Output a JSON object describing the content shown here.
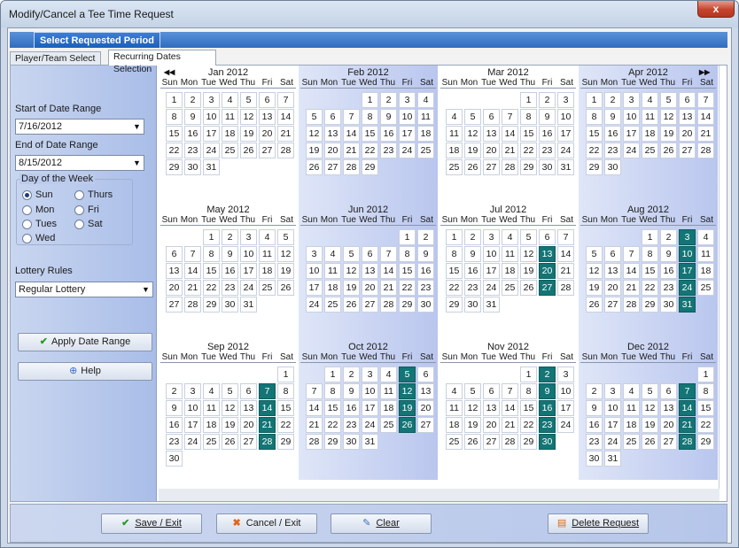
{
  "window": {
    "title": "Modify/Cancel a Tee Time Request",
    "close_label": "x"
  },
  "period_header": {
    "label": "Select Requested Period"
  },
  "tabs": [
    {
      "label": "Player/Team Select",
      "active": false
    },
    {
      "label": "Recurring Dates Selection",
      "active": true
    }
  ],
  "sidebar": {
    "start_label": "Start of Date Range",
    "start_value": "7/16/2012",
    "end_label": "End of Date Range",
    "end_value": "8/15/2012",
    "dow_title": "Day of the Week",
    "days": [
      {
        "label": "Sun",
        "selected": true
      },
      {
        "label": "Thurs",
        "selected": false
      },
      {
        "label": "Mon",
        "selected": false
      },
      {
        "label": "Fri",
        "selected": false
      },
      {
        "label": "Tues",
        "selected": false
      },
      {
        "label": "Sat",
        "selected": false
      },
      {
        "label": "Wed",
        "selected": false
      }
    ],
    "lottery_label": "Lottery Rules",
    "lottery_value": "Regular Lottery",
    "apply_button": "Apply Date Range",
    "help_button": "Help"
  },
  "calendar": {
    "weekdays": [
      "Sun",
      "Mon",
      "Tue",
      "Wed",
      "Thu",
      "Fri",
      "Sat"
    ],
    "prev_icon": "double-left-arrow",
    "next_icon": "double-right-arrow",
    "months": [
      {
        "title": "Jan 2012",
        "start": 0,
        "days": 31,
        "selected": []
      },
      {
        "title": "Feb 2012",
        "start": 3,
        "days": 29,
        "selected": []
      },
      {
        "title": "Mar 2012",
        "start": 4,
        "days": 31,
        "selected": []
      },
      {
        "title": "Apr 2012",
        "start": 0,
        "days": 30,
        "selected": []
      },
      {
        "title": "May 2012",
        "start": 2,
        "days": 31,
        "selected": []
      },
      {
        "title": "Jun 2012",
        "start": 5,
        "days": 30,
        "selected": []
      },
      {
        "title": "Jul 2012",
        "start": 0,
        "days": 31,
        "selected": [
          13,
          20,
          27
        ]
      },
      {
        "title": "Aug 2012",
        "start": 3,
        "days": 31,
        "selected": [
          3,
          10,
          17,
          24,
          31
        ]
      },
      {
        "title": "Sep 2012",
        "start": 6,
        "days": 30,
        "selected": [
          7,
          14,
          21,
          28
        ]
      },
      {
        "title": "Oct 2012",
        "start": 1,
        "days": 31,
        "selected": [
          5,
          12,
          19,
          26
        ]
      },
      {
        "title": "Nov 2012",
        "start": 4,
        "days": 30,
        "selected": [
          2,
          9,
          16,
          23,
          30
        ]
      },
      {
        "title": "Dec 2012",
        "start": 6,
        "days": 31,
        "selected": [
          7,
          14,
          21,
          28
        ]
      }
    ]
  },
  "buttons": {
    "save": "Save / Exit",
    "cancel": "Cancel / Exit",
    "clear": "Clear",
    "delete": "Delete Request"
  },
  "colors": {
    "selected_day": "#137575",
    "header_blue": "#2f6cc0"
  }
}
